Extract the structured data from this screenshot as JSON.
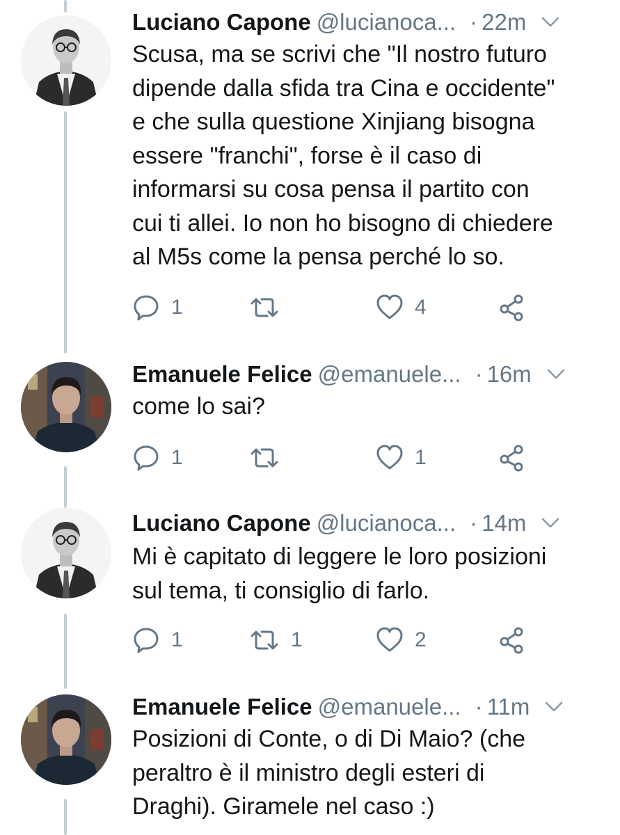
{
  "colors": {
    "text": "#14171a",
    "secondary": "#657786",
    "thread_line": "#c4cfd6"
  },
  "tweets": [
    {
      "avatar": "luciano-capone-avatar",
      "name": "Luciano Capone",
      "handle": "@lucianoca...",
      "separator": "·",
      "time": "22m",
      "lines": [
        "Scusa, ma se scrivi che \"Il nostro futuro",
        "dipende dalla sfida tra Cina e occidente\"",
        "e che sulla questione Xinjiang bisogna",
        "essere \"franchi\", forse è il caso di",
        "informarsi su cosa pensa il partito con",
        "cui ti allei. Io non ho bisogno di chiedere",
        "al M5s come la pensa perché lo so."
      ],
      "replies": "1",
      "retweets": "",
      "likes": "4"
    },
    {
      "avatar": "emanuele-felice-avatar",
      "name": "Emanuele Felice",
      "handle": "@emanuele...",
      "separator": "·",
      "time": "16m",
      "lines": [
        "come lo sai?"
      ],
      "replies": "1",
      "retweets": "",
      "likes": "1"
    },
    {
      "avatar": "luciano-capone-avatar",
      "name": "Luciano Capone",
      "handle": "@lucianoca...",
      "separator": "·",
      "time": "14m",
      "lines": [
        "Mi è capitato di leggere le loro posizioni",
        "sul tema, ti consiglio di farlo."
      ],
      "replies": "1",
      "retweets": "1",
      "likes": "2"
    },
    {
      "avatar": "emanuele-felice-avatar",
      "name": "Emanuele Felice",
      "handle": "@emanuele...",
      "separator": "·",
      "time": "11m",
      "lines": [
        "Posizioni di Conte, o di Di Maio? (che",
        "peraltro è il ministro degli esteri di",
        "Draghi). Giramele nel caso :)"
      ]
    }
  ]
}
